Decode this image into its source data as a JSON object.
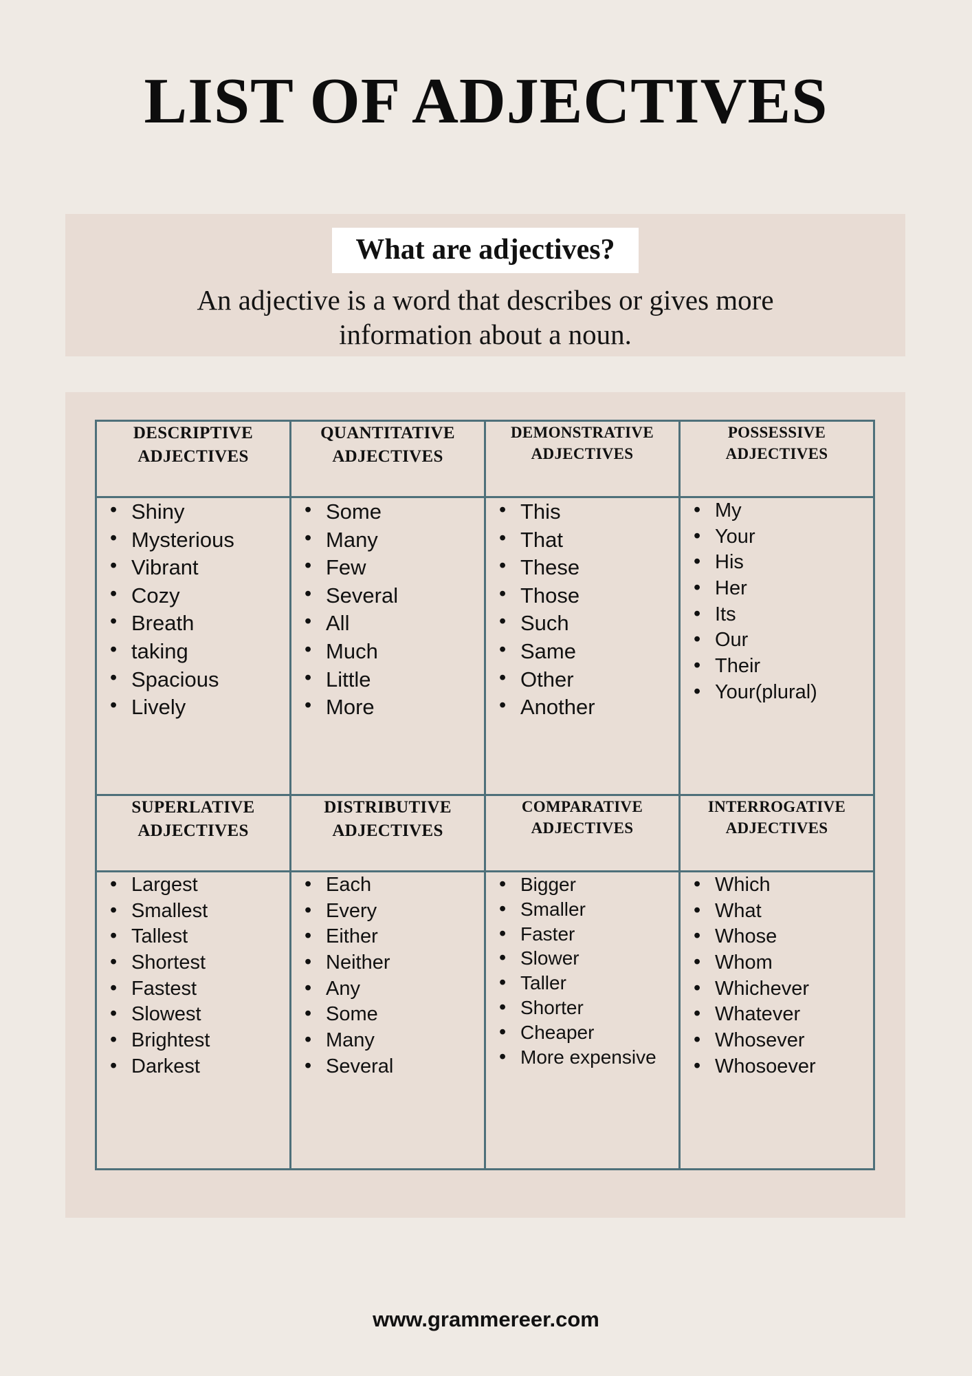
{
  "page": {
    "title": "LIST OF ADJECTIVES",
    "background_color": "#efeae4",
    "band_color": "#e8dcd4",
    "border_color": "#4e707a"
  },
  "definition": {
    "heading": "What are adjectives?",
    "body": "An adjective is a word that describes or gives more information about a noun."
  },
  "table": {
    "rows": [
      {
        "columns": [
          {
            "header": "DESCRIPTIVE ADJECTIVES",
            "items": [
              "Shiny",
              "Mysterious",
              "Vibrant",
              "Cozy",
              "Breath",
              "taking",
              "Spacious",
              "Lively"
            ]
          },
          {
            "header": "QUANTITATIVE ADJECTIVES",
            "items": [
              "Some",
              "Many",
              "Few",
              "Several",
              "All",
              "Much",
              "Little",
              "More"
            ]
          },
          {
            "header": "DEMONSTRATIVE ADJECTIVES",
            "items": [
              "This",
              "That",
              "These",
              "Those",
              "Such",
              "Same",
              "Other",
              "Another"
            ]
          },
          {
            "header": "POSSESSIVE ADJECTIVES",
            "items": [
              "My",
              "Your",
              "His",
              "Her",
              "Its",
              "Our",
              "Their",
              "Your(plural)"
            ]
          }
        ]
      },
      {
        "columns": [
          {
            "header": "SUPERLATIVE ADJECTIVES",
            "items": [
              "Largest",
              "Smallest",
              "Tallest",
              "Shortest",
              "Fastest",
              "Slowest",
              "Brightest",
              "Darkest"
            ]
          },
          {
            "header": "DISTRIBUTIVE ADJECTIVES",
            "items": [
              "Each",
              "Every",
              "Either",
              "Neither",
              "Any",
              "Some",
              "Many",
              "Several"
            ]
          },
          {
            "header": "COMPARATIVE ADJECTIVES",
            "items": [
              "Bigger",
              "Smaller",
              "Faster",
              "Slower",
              "Taller",
              "Shorter",
              "Cheaper",
              "More expensive"
            ]
          },
          {
            "header": "INTERROGATIVE ADJECTIVES",
            "items": [
              "Which",
              "What",
              "Whose",
              "Whom",
              "Whichever",
              "Whatever",
              "Whosever",
              "Whosoever"
            ]
          }
        ]
      }
    ]
  },
  "footer": {
    "url": "www.grammereer.com"
  }
}
